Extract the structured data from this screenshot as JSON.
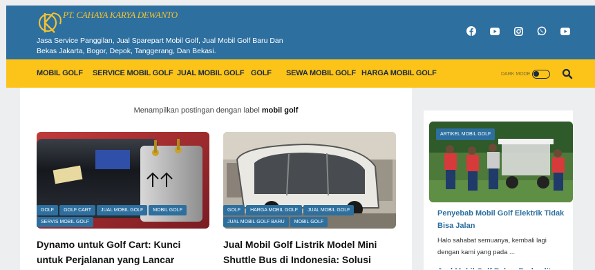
{
  "header": {
    "logo_text": "PT. CAHAYA KARYA DEWANTO",
    "tagline": "Jasa Service Panggilan, Jual Sparepart Mobil Golf, Jual Mobil Golf Baru Dan Bekas Jakarta, Bogor, Depok, Tanggerang, Dan Bekasi.",
    "social_icons": [
      "facebook-icon",
      "youtube-icon",
      "instagram-icon",
      "whatsapp-icon",
      "youtube-icon"
    ]
  },
  "nav": {
    "items": [
      "MOBIL GOLF",
      "SERVICE MOBIL GOLF",
      "JUAL MOBIL GOLF",
      "GOLF",
      "SEWA MOBIL GOLF",
      "HARGA MOBIL GOLF"
    ],
    "dark_mode_label": "DARK MODE"
  },
  "main": {
    "label_prefix": "Menampilkan postingan dengan label",
    "label_value": "mobil golf",
    "posts": [
      {
        "tags": [
          "GOLF",
          "GOLF CART",
          "JUAL MOBIL GOLF",
          "MOBIL GOLF",
          "SERVIS MOBIL GOLF"
        ],
        "title": "Dynamo untuk Golf Cart: Kunci untuk Perjalanan yang Lancar"
      },
      {
        "tags": [
          "GOLF",
          "HARGA MOBIL GOLF",
          "JUAL MOBIL GOLF",
          "JUAL MOBIL GOLF BARU",
          "MOBIL GOLF"
        ],
        "title": "Jual Mobil Golf Listrik Model Mini Shuttle Bus di Indonesia: Solusi Transportasi Ramah Lingkungan"
      }
    ]
  },
  "sidebar": {
    "badge": "ARTIKEL MOBIL GOLF",
    "title": "Penyebab Mobil Golf Elektrik Tidak Bisa Jalan",
    "excerpt": "Halo sahabat semuanya, kembali lagi dengan kami yang pada ...",
    "next_title": "Jual Mobil Golf Bekas Berkualitas"
  },
  "colors": {
    "header_blue": "#2d6f9f",
    "nav_yellow": "#fcc419",
    "logo_gold": "#f1c232"
  }
}
